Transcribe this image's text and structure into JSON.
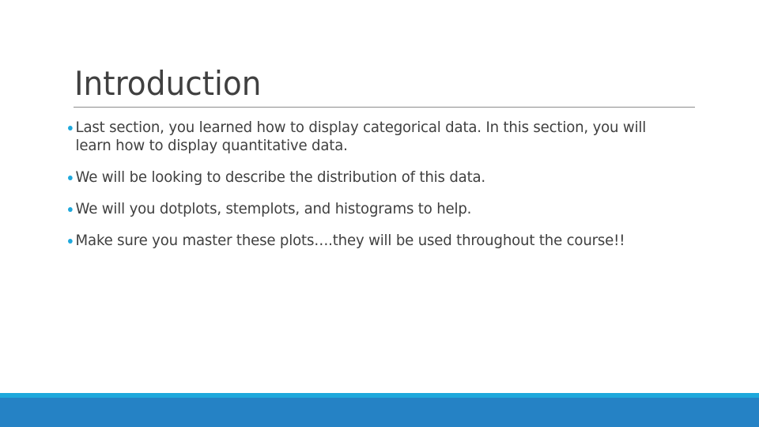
{
  "slide": {
    "title": "Introduction",
    "bullets": [
      {
        "text": "Last section, you learned how to display categorical data.  In this section, you will learn how to display quantitative data."
      },
      {
        "text": "We will be looking to describe the distribution of this data."
      },
      {
        "text": "We will you dotplots, stemplots, and histograms to help."
      },
      {
        "text": "Make sure you master these plots….they will be used throughout the course!!"
      }
    ]
  },
  "theme": {
    "accent": "#1ea8dc",
    "footer": "#2582c5",
    "text": "#404040",
    "rule": "#8c8c8c"
  }
}
